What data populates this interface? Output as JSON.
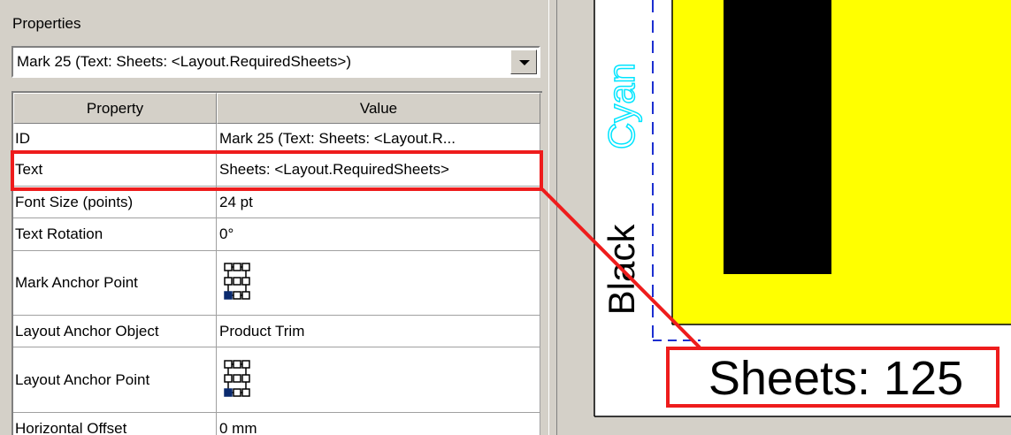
{
  "panel": {
    "title": "Properties",
    "selector_value": "Mark 25 (Text: Sheets: <Layout.RequiredSheets>)"
  },
  "grid": {
    "headers": [
      "Property",
      "Value"
    ],
    "rows": [
      {
        "property": "ID",
        "value": "Mark 25 (Text: Sheets: <Layout.R..."
      },
      {
        "property": "Text",
        "value": "Sheets: <Layout.RequiredSheets>"
      },
      {
        "property": "Font Size (points)",
        "value": "24 pt"
      },
      {
        "property": "Text Rotation",
        "value": "0°"
      },
      {
        "property": "Mark Anchor Point",
        "value": ""
      },
      {
        "property": "Layout Anchor Object",
        "value": "Product Trim"
      },
      {
        "property": "Layout Anchor Point",
        "value": ""
      },
      {
        "property": "Horizontal Offset",
        "value": "0 mm"
      }
    ]
  },
  "preview": {
    "cyan_label": "Cyan",
    "black_label": "Black",
    "sheets_text": "Sheets: 125"
  },
  "colors": {
    "highlight": "#ee1c1c",
    "yellow": "#ffff00",
    "cyan": "#00ffff",
    "guide": "#1c2fd0",
    "anchor_selected": "#0a2a6e"
  }
}
